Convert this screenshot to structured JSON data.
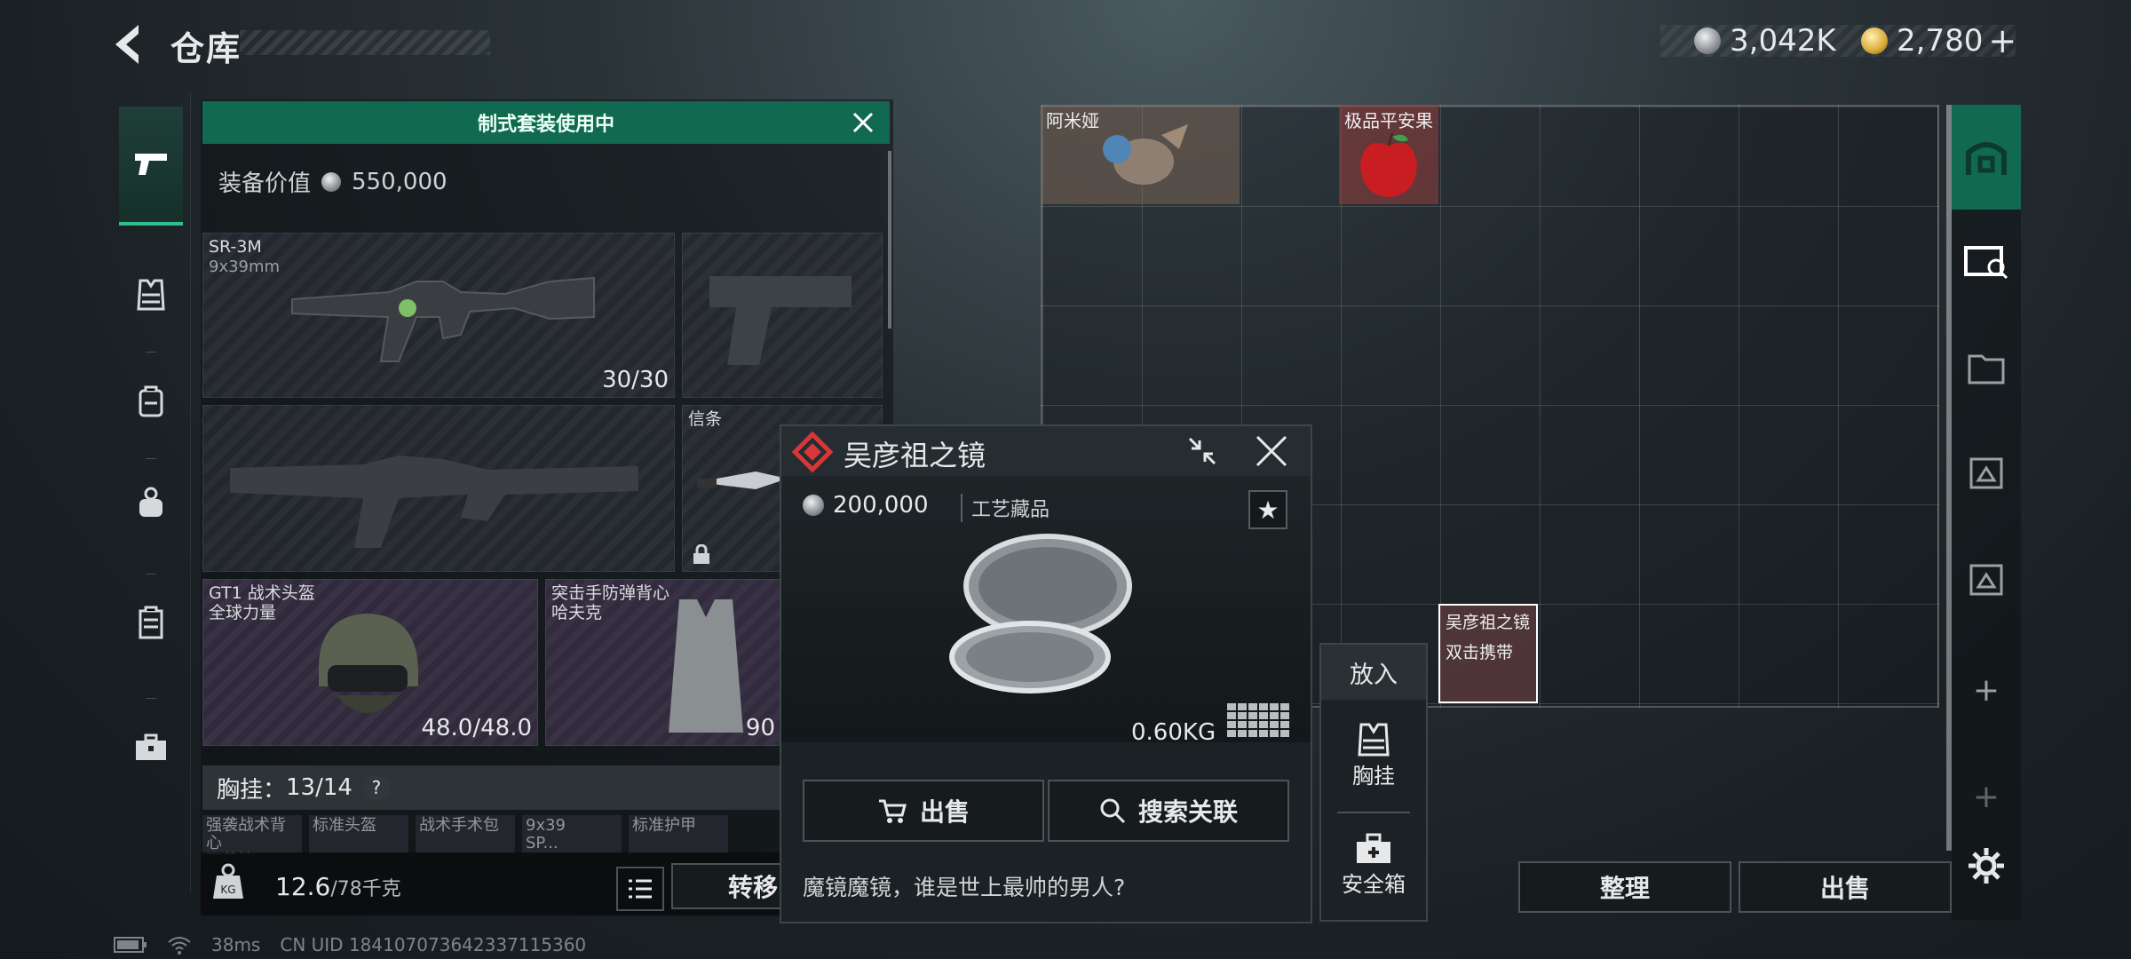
{
  "header": {
    "title": "仓库",
    "currency_silver": "3,042K",
    "currency_gold": "2,780",
    "add_label": "+"
  },
  "loadout": {
    "banner": "制式套装使用中",
    "value_label": "装备价值",
    "value": "550,000",
    "primary": {
      "name": "SR-3M",
      "caliber": "9x39mm",
      "ammo": "30/30"
    },
    "slot_xintiao": "信条",
    "helmet": {
      "name": "GT1 战术头盔",
      "brand": "全球力量",
      "durability": "48.0/48.0"
    },
    "vest": {
      "name": "突击手防弹背心",
      "brand": "哈夫克",
      "durability": "90"
    },
    "chest_rig": {
      "label": "胸挂：",
      "count": "13/14",
      "help": "?"
    },
    "small_slots": [
      "强袭战术背心\n阿萨拉",
      "标准头盔",
      "战术手术包",
      "9x39\nSP...",
      "标准护甲"
    ],
    "weight_value": "12.6",
    "weight_max": "/78千克",
    "transfer_label": "转移"
  },
  "popup": {
    "item_name": "吴彦祖之镜",
    "price": "200,000",
    "category": "工艺藏品",
    "weight": "0.60KG",
    "sell_label": "出售",
    "search_label": "搜索关联",
    "description": "魔镜魔镜，谁是世上最帅的男人?"
  },
  "put_in": {
    "title": "放入",
    "chest_label": "胸挂",
    "safe_label": "安全箱"
  },
  "storage": {
    "items": [
      {
        "name": "阿米娅"
      },
      {
        "name": "极品平安果"
      },
      {
        "name": "吴彦祖之镜",
        "hint": "双击携带"
      }
    ],
    "organize_label": "整理",
    "sell_label": "出售",
    "add_tab": "+"
  },
  "status": {
    "ping": "38ms",
    "uid": "CN UID 184107073642337115360"
  },
  "colors": {
    "accent_green": "#11694f",
    "rarity_red": "#d8363a"
  }
}
